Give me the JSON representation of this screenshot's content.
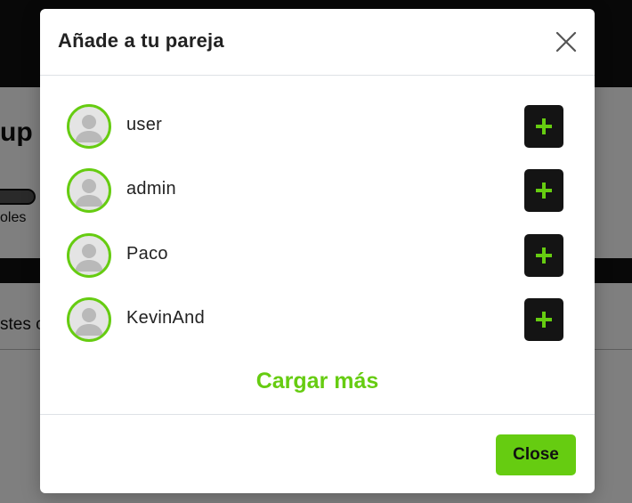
{
  "background": {
    "title_fragment": "up",
    "small_fragment": "oles",
    "text_fragment": "stes c"
  },
  "modal": {
    "title": "Añade a tu pareja",
    "users": [
      {
        "name": "user"
      },
      {
        "name": "admin"
      },
      {
        "name": "Paco"
      },
      {
        "name": "KevinAnd"
      }
    ],
    "add_label": "+",
    "load_more": "Cargar más",
    "close_label": "Close"
  },
  "colors": {
    "accent": "#66cc11",
    "dark": "#141414"
  },
  "icons": {
    "close": "close-icon",
    "avatar": "user-silhouette-icon",
    "add": "plus-icon"
  }
}
